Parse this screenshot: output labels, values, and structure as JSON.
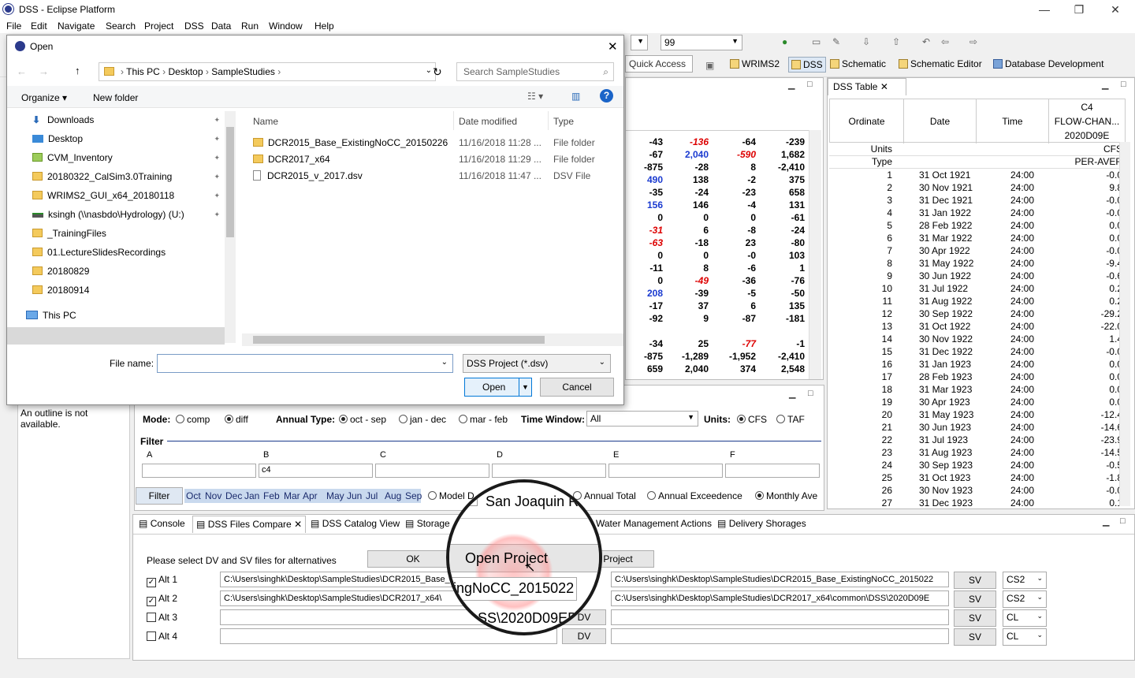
{
  "window": {
    "title": "DSS - Eclipse Platform",
    "controls": [
      "—",
      "❐",
      "✕"
    ]
  },
  "menu": [
    "File",
    "Edit",
    "Navigate",
    "Search",
    "Project",
    "DSS",
    "Data",
    "Run",
    "Window",
    "Help"
  ],
  "toolbar": {
    "combo_value": "99",
    "quick_access_placeholder": "Quick Access",
    "perspectives": [
      "WRIMS2",
      "DSS",
      "Schematic",
      "Schematic Editor",
      "Database Development"
    ]
  },
  "dss_table": {
    "tab_label": "DSS Table",
    "headers": [
      "Ordinate",
      "Date",
      "Time",
      "C4\nFLOW-CHAN...\n2020D09E"
    ],
    "units_label": "Units",
    "units_value": "CFS",
    "type_label": "Type",
    "type_value": "PER-AVER",
    "rows": [
      [
        "1",
        "31 Oct 1921",
        "24:00",
        "-0.0"
      ],
      [
        "2",
        "30 Nov 1921",
        "24:00",
        "9.8"
      ],
      [
        "3",
        "31 Dec 1921",
        "24:00",
        "-0.0"
      ],
      [
        "4",
        "31 Jan 1922",
        "24:00",
        "-0.0"
      ],
      [
        "5",
        "28 Feb 1922",
        "24:00",
        "0.0"
      ],
      [
        "6",
        "31 Mar 1922",
        "24:00",
        "0.0"
      ],
      [
        "7",
        "30 Apr 1922",
        "24:00",
        "-0.0"
      ],
      [
        "8",
        "31 May 1922",
        "24:00",
        "-9.4"
      ],
      [
        "9",
        "30 Jun 1922",
        "24:00",
        "-0.6"
      ],
      [
        "10",
        "31 Jul 1922",
        "24:00",
        "0.2"
      ],
      [
        "11",
        "31 Aug 1922",
        "24:00",
        "0.2"
      ],
      [
        "12",
        "30 Sep 1922",
        "24:00",
        "-29.2"
      ],
      [
        "13",
        "31 Oct 1922",
        "24:00",
        "-22.0"
      ],
      [
        "14",
        "30 Nov 1922",
        "24:00",
        "1.4"
      ],
      [
        "15",
        "31 Dec 1922",
        "24:00",
        "-0.0"
      ],
      [
        "16",
        "31 Jan 1923",
        "24:00",
        "0.0"
      ],
      [
        "17",
        "28 Feb 1923",
        "24:00",
        "0.0"
      ],
      [
        "18",
        "31 Mar 1923",
        "24:00",
        "0.0"
      ],
      [
        "19",
        "30 Apr 1923",
        "24:00",
        "0.0"
      ],
      [
        "20",
        "31 May 1923",
        "24:00",
        "-12.4"
      ],
      [
        "21",
        "30 Jun 1923",
        "24:00",
        "-14.6"
      ],
      [
        "22",
        "31 Jul 1923",
        "24:00",
        "-23.9"
      ],
      [
        "23",
        "31 Aug 1923",
        "24:00",
        "-14.5"
      ],
      [
        "24",
        "30 Sep 1923",
        "24:00",
        "-0.5"
      ],
      [
        "25",
        "31 Oct 1923",
        "24:00",
        "-1.8"
      ],
      [
        "26",
        "30 Nov 1923",
        "24:00",
        "-0.0"
      ],
      [
        "27",
        "31 Dec 1923",
        "24:00",
        "0.1"
      ]
    ]
  },
  "data_grid": {
    "rows": [
      [
        "-43",
        "-136",
        "-64",
        "-239"
      ],
      [
        "-67",
        "2,040",
        "-590",
        "1,682"
      ],
      [
        "-875",
        "-28",
        "8",
        "-2,410"
      ],
      [
        "490",
        "138",
        "-2",
        "375"
      ],
      [
        "-35",
        "-24",
        "-23",
        "658"
      ],
      [
        "156",
        "146",
        "-4",
        "131"
      ],
      [
        "0",
        "0",
        "0",
        "-61"
      ],
      [
        "-31",
        "6",
        "-8",
        "-24"
      ],
      [
        "-63",
        "-18",
        "23",
        "-80"
      ],
      [
        "0",
        "0",
        "-0",
        "103"
      ],
      [
        "-11",
        "8",
        "-6",
        "1"
      ],
      [
        "0",
        "-49",
        "-36",
        "-76"
      ],
      [
        "208",
        "-39",
        "-5",
        "-50"
      ],
      [
        "-17",
        "37",
        "6",
        "135"
      ],
      [
        "-92",
        "9",
        "-87",
        "-181"
      ],
      [
        "",
        "",
        "",
        ""
      ],
      [
        "-34",
        "25",
        "-77",
        "-1"
      ],
      [
        "-875",
        "-1,289",
        "-1,952",
        "-2,410"
      ],
      [
        "659",
        "2,040",
        "374",
        "2,548"
      ]
    ],
    "red_cells": [
      "0-1",
      "1-2",
      "7-0",
      "8-0",
      "11-1",
      "16-2"
    ],
    "blue_cells": [
      "1-1",
      "3-0",
      "5-0",
      "12-0"
    ]
  },
  "outline": {
    "message": "An outline is not available."
  },
  "filter_panel": {
    "mode_label": "Mode:",
    "mode_comp": "comp",
    "mode_diff": "diff",
    "annual_type_label": "Annual Type:",
    "annual_oct": "oct - sep",
    "annual_jan": "jan - dec",
    "annual_mar": "mar - feb",
    "time_window_label": "Time Window:",
    "time_window_value": "All",
    "units_label": "Units:",
    "units_cfs": "CFS",
    "units_taf": "TAF",
    "filter_title": "Filter",
    "fields": [
      {
        "label": "A",
        "value": ""
      },
      {
        "label": "B",
        "value": "c4"
      },
      {
        "label": "C",
        "value": ""
      },
      {
        "label": "D",
        "value": ""
      },
      {
        "label": "E",
        "value": ""
      },
      {
        "label": "F",
        "value": ""
      }
    ],
    "filter_button": "Filter",
    "months": [
      "Oct",
      "Nov",
      "Dec",
      "Jan",
      "Feb",
      "Mar",
      "Apr",
      "May",
      "Jun",
      "Jul",
      "Aug",
      "Sep"
    ],
    "opt_model": "Model D",
    "opt_annual_total": "Annual Total",
    "opt_annual_exceed": "Annual Exceedence",
    "opt_monthly": "Monthly Ave"
  },
  "bottom_tabs": [
    "Console",
    "DSS Files Compare",
    "DSS Catalog View",
    "Storage",
    "Water Management Actions",
    "Delivery Shorages"
  ],
  "compare": {
    "instruction": "Please select DV and SV files for alternatives",
    "ok": "OK",
    "open_project": "Project",
    "alts": [
      {
        "label": "Alt 1",
        "checked": true,
        "dv": "C:\\Users\\singhk\\Desktop\\SampleStudies\\DCR2015_Base_ExistingNoCC_20150226",
        "sv": "C:\\Users\\singhk\\Desktop\\SampleStudies\\DCR2015_Base_ExistingNoCC_2015022",
        "sv_btn": "SV",
        "dv_btn": "DV",
        "level": "CS2"
      },
      {
        "label": "Alt 2",
        "checked": true,
        "dv": "C:\\Users\\singhk\\Desktop\\SampleStudies\\DCR2017_x64\\",
        "sv": "C:\\Users\\singhk\\Desktop\\SampleStudies\\DCR2017_x64\\common\\DSS\\2020D09E",
        "sv_btn": "SV",
        "dv_btn": "DV",
        "level": "CS2"
      },
      {
        "label": "Alt 3",
        "checked": false,
        "dv": "",
        "sv": "",
        "sv_btn": "SV",
        "dv_btn": "DV",
        "level": "CL"
      },
      {
        "label": "Alt 4",
        "checked": false,
        "dv": "",
        "sv": "",
        "sv_btn": "SV",
        "dv_btn": "DV",
        "level": "CL"
      }
    ]
  },
  "dialog": {
    "title": "Open",
    "path": [
      "This PC",
      "Desktop",
      "SampleStudies"
    ],
    "search_placeholder": "Search SampleStudies",
    "organize": "Organize ▾",
    "new_folder": "New folder",
    "nav_items": [
      "Downloads",
      "Desktop",
      "CVM_Inventory",
      "20180322_CalSim3.0Training",
      "WRIMS2_GUI_x64_20180118",
      "ksingh (\\\\nasbdo\\Hydrology) (U:)",
      "_TrainingFiles",
      "01.LectureSlidesRecordings",
      "20180829",
      "20180914",
      "This PC",
      "Desktop"
    ],
    "columns": [
      "Name",
      "Date modified",
      "Type"
    ],
    "files": [
      {
        "name": "DCR2015_Base_ExistingNoCC_20150226",
        "date": "11/16/2018 11:28 ...",
        "type": "File folder"
      },
      {
        "name": "DCR2017_x64",
        "date": "11/16/2018 11:29 ...",
        "type": "File folder"
      },
      {
        "name": "DCR2015_v_2017.dsv",
        "date": "11/16/2018 11:47 ...",
        "type": "DSV File"
      }
    ],
    "file_name_label": "File name:",
    "file_name_value": "",
    "file_type": "DSS Project (*.dsv)",
    "open_button": "Open",
    "cancel_button": "Cancel"
  },
  "magnifier": {
    "line1": "San Joaquin Riv",
    "button": "Open Project",
    "line2": "tingNoCC_2015022",
    "line3": "SS\\2020D09ED\\"
  }
}
